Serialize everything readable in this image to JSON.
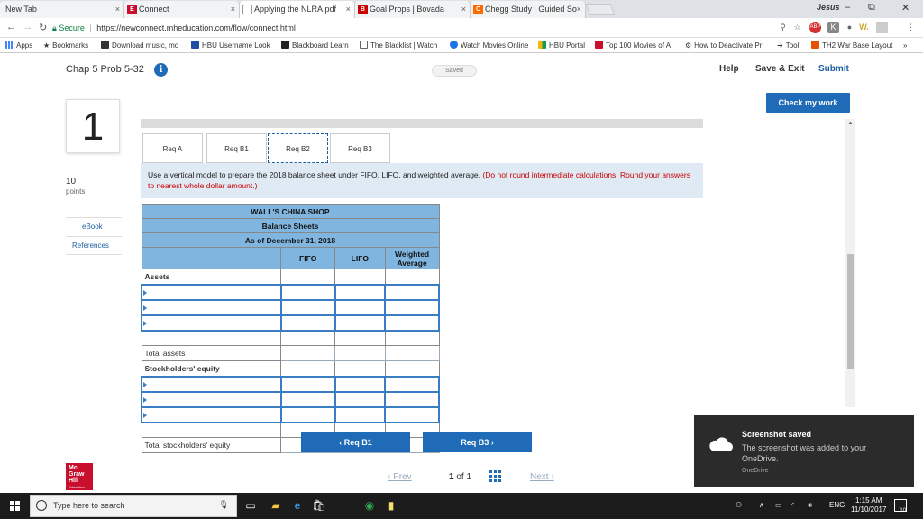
{
  "browser": {
    "tabs": [
      {
        "label": "New Tab",
        "favicon": "",
        "color": "#dee1e6"
      },
      {
        "label": "Connect",
        "favicon": "E",
        "color": "#c8102e"
      },
      {
        "label": "Applying the NLRA.pdf",
        "favicon": "",
        "color": "#888888"
      },
      {
        "label": "Goal Props | Bovada",
        "favicon": "B",
        "color": "#cc0000"
      },
      {
        "label": "Chegg Study | Guided So",
        "favicon": "C",
        "color": "#ff6a00"
      }
    ],
    "profile_name": "Jesus",
    "secure_label": "Secure",
    "url": "https://newconnect.mheducation.com/flow/connect.html",
    "bookmarks": [
      "Apps",
      "Bookmarks",
      "Download music, mo",
      "HBU Username Look",
      "Blackboard Learn",
      "The Blacklist | Watch",
      "Watch Movies Online",
      "HBU Portal",
      "Top 100 Movies of A",
      "How to Deactivate Pr",
      "Tool",
      "TH2 War Base Layout"
    ]
  },
  "header": {
    "assignment_title": "Chap 5 Prob 5-32",
    "saved_label": "Saved",
    "help_label": "Help",
    "save_exit_label": "Save & Exit",
    "submit_label": "Submit"
  },
  "sidebar": {
    "question_number": "1",
    "points_value": "10",
    "points_label": "points",
    "ebook_label": "eBook",
    "references_label": "References"
  },
  "main": {
    "check_button": "Check my work",
    "tabs": [
      "Req A",
      "Req B1",
      "Req B2",
      "Req B3"
    ],
    "active_tab": "Req B2",
    "instruction_main": "Use a vertical model to prepare the 2018 balance sheet under FIFO, LIFO, and weighted average.",
    "instruction_red": "(Do not round intermediate calculations. Round your answers to nearest whole dollar amount.)",
    "table": {
      "company": "WALL'S CHINA SHOP",
      "statement": "Balance Sheets",
      "date": "As of December 31, 2018",
      "columns": [
        "FIFO",
        "LIFO",
        "Weighted Average"
      ],
      "assets_label": "Assets",
      "total_assets_label": "Total assets",
      "equity_label": "Stockholders' equity",
      "total_equity_label": "Total stockholders' equity"
    },
    "prev_req_button": "Req B1",
    "next_req_button": "Req B3"
  },
  "footer": {
    "logo_line1": "Mc",
    "logo_line2": "Graw",
    "logo_line3": "Hill",
    "logo_line4": "Education",
    "prev_label": "Prev",
    "page_current": "1",
    "page_of": "of",
    "page_total": "1",
    "next_label": "Next"
  },
  "toast": {
    "title": "Screenshot saved",
    "body": "The screenshot was added to your OneDrive.",
    "app": "OneDrive"
  },
  "taskbar": {
    "search_placeholder": "Type here to search",
    "language": "ENG",
    "time": "1:15 AM",
    "date": "11/10/2017",
    "notification_count": "10"
  }
}
